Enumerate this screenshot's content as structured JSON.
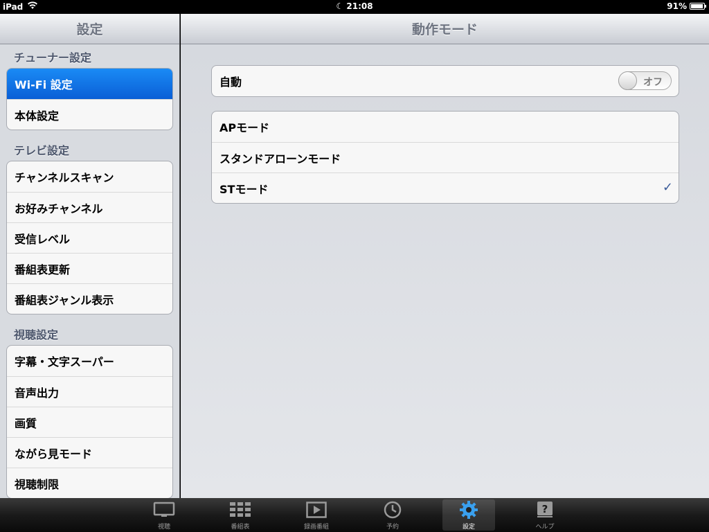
{
  "status": {
    "device": "iPad",
    "time": "21:08",
    "battery": "91%",
    "battery_level": 0.91
  },
  "sidebar": {
    "title": "設定",
    "sections": [
      {
        "header": "チューナー設定",
        "items": [
          "Wi-Fi 設定",
          "本体設定"
        ]
      },
      {
        "header": "テレビ設定",
        "items": [
          "チャンネルスキャン",
          "お好みチャンネル",
          "受信レベル",
          "番組表更新",
          "番組表ジャンル表示"
        ]
      },
      {
        "header": "視聴設定",
        "items": [
          "字幕・文字スーパー",
          "音声出力",
          "画質",
          "ながら見モード",
          "視聴制限"
        ]
      }
    ],
    "selected": "Wi-Fi 設定"
  },
  "main": {
    "title": "動作モード",
    "auto": {
      "label": "自動",
      "toggle": "オフ",
      "on": false
    },
    "modes": [
      "APモード",
      "スタンドアローンモード",
      "STモード"
    ],
    "selected_mode": "STモード",
    "check": "✓"
  },
  "tabs": [
    {
      "label": "視聴",
      "icon": "tv-icon"
    },
    {
      "label": "番組表",
      "icon": "grid-icon"
    },
    {
      "label": "録画番組",
      "icon": "play-icon"
    },
    {
      "label": "予約",
      "icon": "clock-icon"
    },
    {
      "label": "設定",
      "icon": "gear-icon",
      "active": true
    },
    {
      "label": "ヘルプ",
      "icon": "help-icon"
    }
  ]
}
